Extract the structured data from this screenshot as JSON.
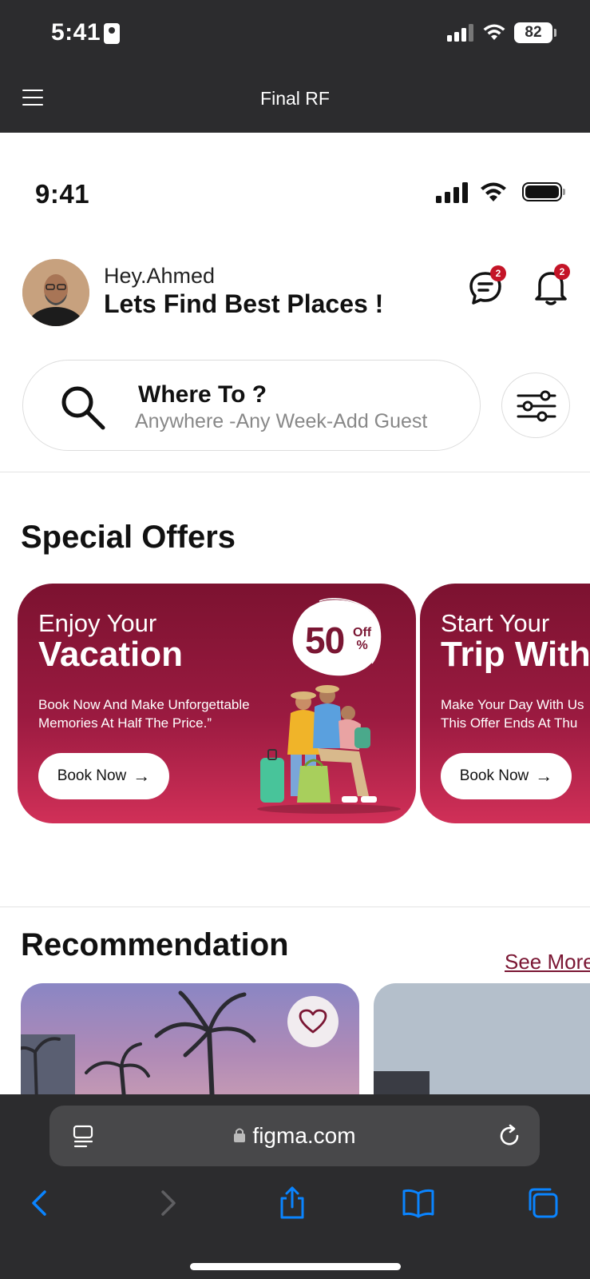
{
  "device": {
    "time": "5:41",
    "battery": "82"
  },
  "browser": {
    "title": "Final RF",
    "url": "figma.com"
  },
  "app": {
    "time": "9:41",
    "user": {
      "greeting": "Hey.Ahmed",
      "headline": "Lets Find Best Places !"
    },
    "messages_badge": "2",
    "notifications_badge": "2",
    "search": {
      "title": "Where To ?",
      "subtitle": "Anywhere -Any Week-Add Guest"
    },
    "special_offers": {
      "title": "Special Offers",
      "cards": [
        {
          "line1": "Enjoy Your",
          "line2": "Vacation",
          "description": "Book Now And Make Unforgettable Memories At Half The Price.”",
          "button": "Book Now",
          "discount": "50",
          "discount_off": "Off",
          "discount_pct": "%"
        },
        {
          "line1": "Start Your",
          "line2": "Trip With",
          "description": "Make Your Day With Us This Offer Ends At Thu",
          "button": "Book Now"
        }
      ]
    },
    "recommendation": {
      "title": "Recommendation",
      "see_more": "See More"
    }
  },
  "colors": {
    "brand": "#7a1633",
    "badge": "#c41427",
    "ios_link": "#0a84ff"
  }
}
